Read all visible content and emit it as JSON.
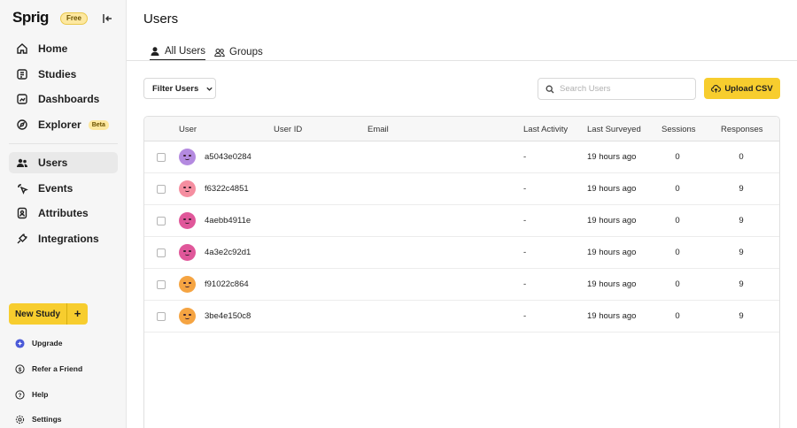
{
  "brand": {
    "name": "Sprig",
    "plan_badge": "Free"
  },
  "sidebar": {
    "primary": [
      {
        "label": "Home",
        "icon": "home-icon"
      },
      {
        "label": "Studies",
        "icon": "studies-icon"
      },
      {
        "label": "Dashboards",
        "icon": "dashboards-icon"
      },
      {
        "label": "Explorer",
        "icon": "explorer-icon",
        "badge": "Beta"
      }
    ],
    "secondary": [
      {
        "label": "Users",
        "icon": "users-icon",
        "active": true
      },
      {
        "label": "Events",
        "icon": "events-icon"
      },
      {
        "label": "Attributes",
        "icon": "attributes-icon"
      },
      {
        "label": "Integrations",
        "icon": "integrations-icon"
      }
    ],
    "new_study_label": "New Study",
    "new_study_plus": "+",
    "footer": [
      {
        "label": "Upgrade",
        "icon": "upgrade-icon"
      },
      {
        "label": "Refer a Friend",
        "icon": "refer-icon"
      },
      {
        "label": "Help",
        "icon": "help-icon"
      },
      {
        "label": "Settings",
        "icon": "settings-icon"
      }
    ]
  },
  "page": {
    "title": "Users",
    "tabs": [
      {
        "label": "All Users",
        "icon": "user-icon",
        "active": true
      },
      {
        "label": "Groups",
        "icon": "groups-icon"
      }
    ],
    "filter_label": "Filter Users",
    "search_placeholder": "Search Users",
    "upload_label": "Upload CSV"
  },
  "table": {
    "columns": [
      "User",
      "User ID",
      "Email",
      "Last Activity",
      "Last Surveyed",
      "Sessions",
      "Responses"
    ],
    "rows": [
      {
        "user": "a5043e0284",
        "user_id": "",
        "email": "",
        "last_activity": "-",
        "last_surveyed": "19 hours ago",
        "sessions": "0",
        "responses": "0",
        "avatar_color": "#b48ae0"
      },
      {
        "user": "f6322c4851",
        "user_id": "",
        "email": "",
        "last_activity": "-",
        "last_surveyed": "19 hours ago",
        "sessions": "0",
        "responses": "9",
        "avatar_color": "#f58ea0"
      },
      {
        "user": "4aebb4911e",
        "user_id": "",
        "email": "",
        "last_activity": "-",
        "last_surveyed": "19 hours ago",
        "sessions": "0",
        "responses": "9",
        "avatar_color": "#e0579a"
      },
      {
        "user": "4a3e2c92d1",
        "user_id": "",
        "email": "",
        "last_activity": "-",
        "last_surveyed": "19 hours ago",
        "sessions": "0",
        "responses": "9",
        "avatar_color": "#e0579a"
      },
      {
        "user": "f91022c864",
        "user_id": "",
        "email": "",
        "last_activity": "-",
        "last_surveyed": "19 hours ago",
        "sessions": "0",
        "responses": "9",
        "avatar_color": "#f5a442"
      },
      {
        "user": "3be4e150c8",
        "user_id": "",
        "email": "",
        "last_activity": "-",
        "last_surveyed": "19 hours ago",
        "sessions": "0",
        "responses": "9",
        "avatar_color": "#f5a442"
      }
    ]
  }
}
